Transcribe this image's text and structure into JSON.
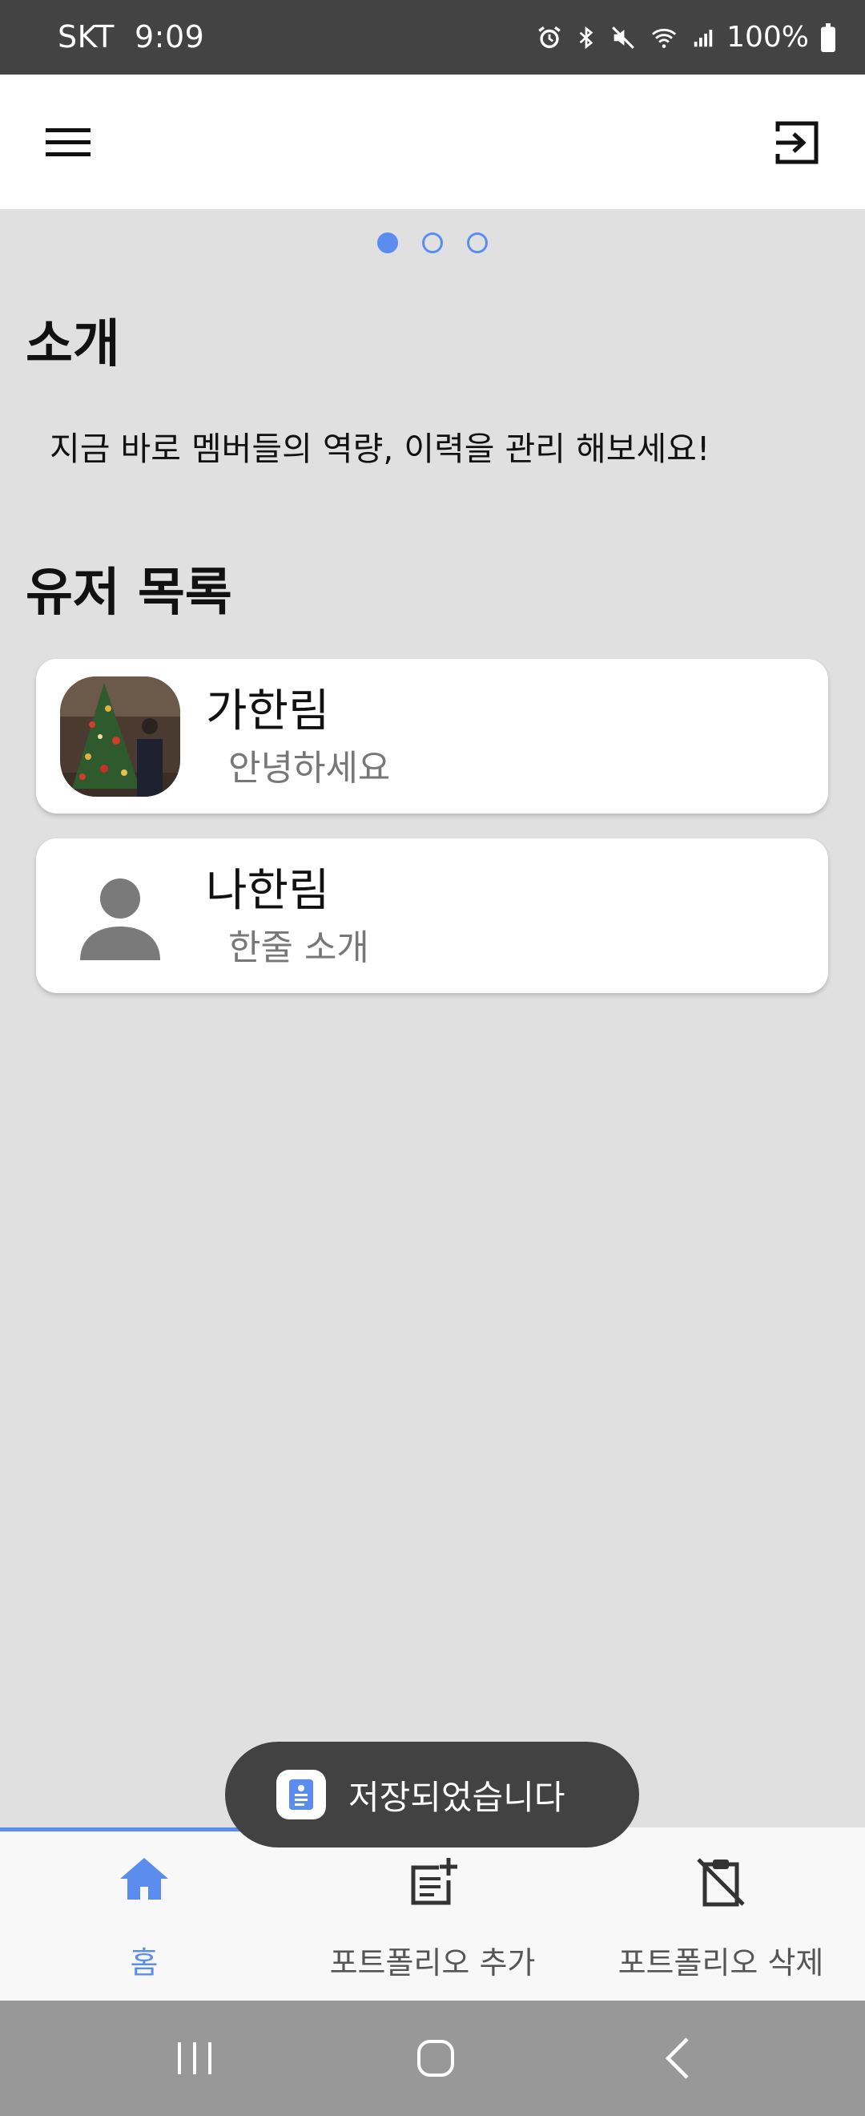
{
  "status_bar": {
    "carrier": "SKT",
    "time": "9:09",
    "battery": "100%"
  },
  "app_bar": {
    "menu_icon": "hamburger-menu-icon",
    "logout_icon": "logout-icon"
  },
  "pager": {
    "total": 3,
    "active_index": 0
  },
  "intro_section": {
    "title": "소개",
    "text": "지금 바로 멤버들의 역량, 이력을 관리 해보세요!"
  },
  "users_section": {
    "title": "유저 목록",
    "users": [
      {
        "name": "가한림",
        "intro": "안녕하세요",
        "avatar": "photo"
      },
      {
        "name": "나한림",
        "intro": "한줄 소개",
        "avatar": "default-person-icon"
      }
    ]
  },
  "toast": {
    "message": "저장되었습니다",
    "icon": "app-document-icon"
  },
  "bottom_nav": {
    "items": [
      {
        "label": "홈",
        "icon": "home-icon",
        "active": true
      },
      {
        "label": "포트폴리오 추가",
        "icon": "add-note-icon",
        "active": false
      },
      {
        "label": "포트폴리오 삭제",
        "icon": "delete-clipboard-icon",
        "active": false
      }
    ]
  },
  "colors": {
    "accent": "#5b8def",
    "background": "#e0e0e0",
    "status_bar": "#434343",
    "toast": "#424242"
  }
}
